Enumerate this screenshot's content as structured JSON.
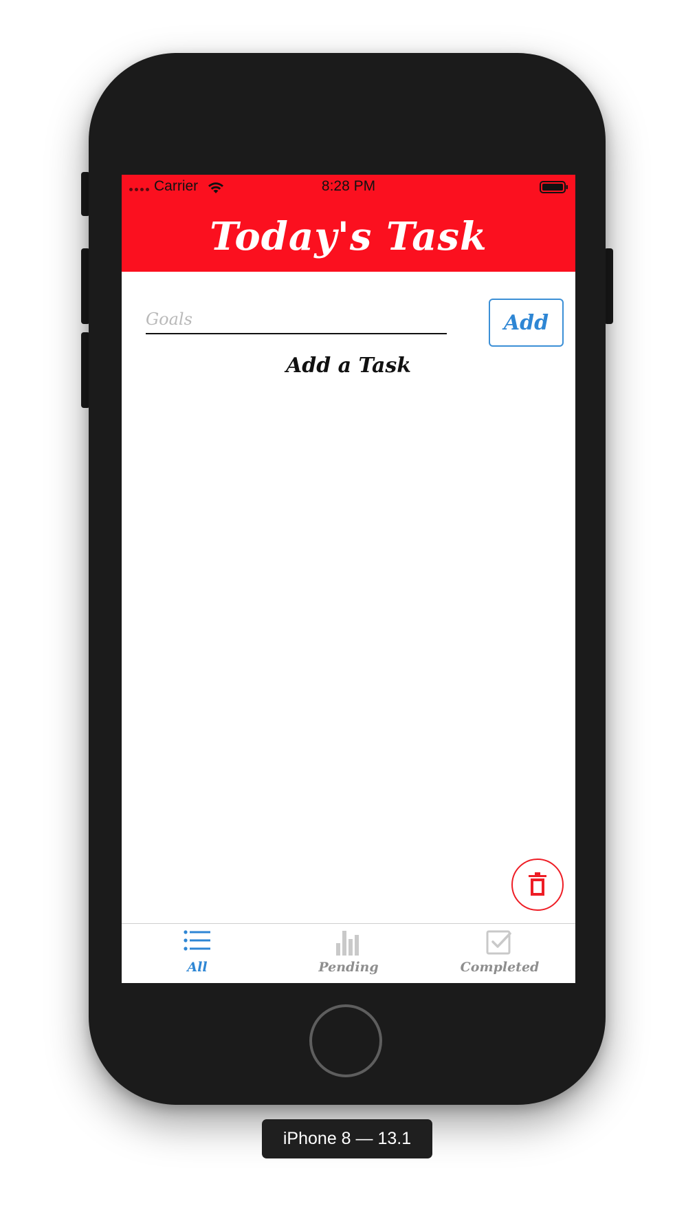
{
  "status_bar": {
    "carrier": "Carrier",
    "time": "8:28 PM"
  },
  "header": {
    "title": "Today's Task"
  },
  "input": {
    "placeholder": "Goals",
    "value": ""
  },
  "add_button": {
    "label": "Add"
  },
  "empty_state": {
    "text": "Add a Task"
  },
  "tabs": [
    {
      "label": "All",
      "icon": "list-icon",
      "active": true
    },
    {
      "label": "Pending",
      "icon": "bar-chart-icon",
      "active": false
    },
    {
      "label": "Completed",
      "icon": "checkbox-icon",
      "active": false
    }
  ],
  "device": {
    "label": "iPhone 8 — 13.1"
  },
  "colors": {
    "header_red": "#fb101f",
    "accent_blue": "#2e86d4",
    "delete_red": "#ee1d25",
    "inactive_gray": "#8e8e8e"
  }
}
